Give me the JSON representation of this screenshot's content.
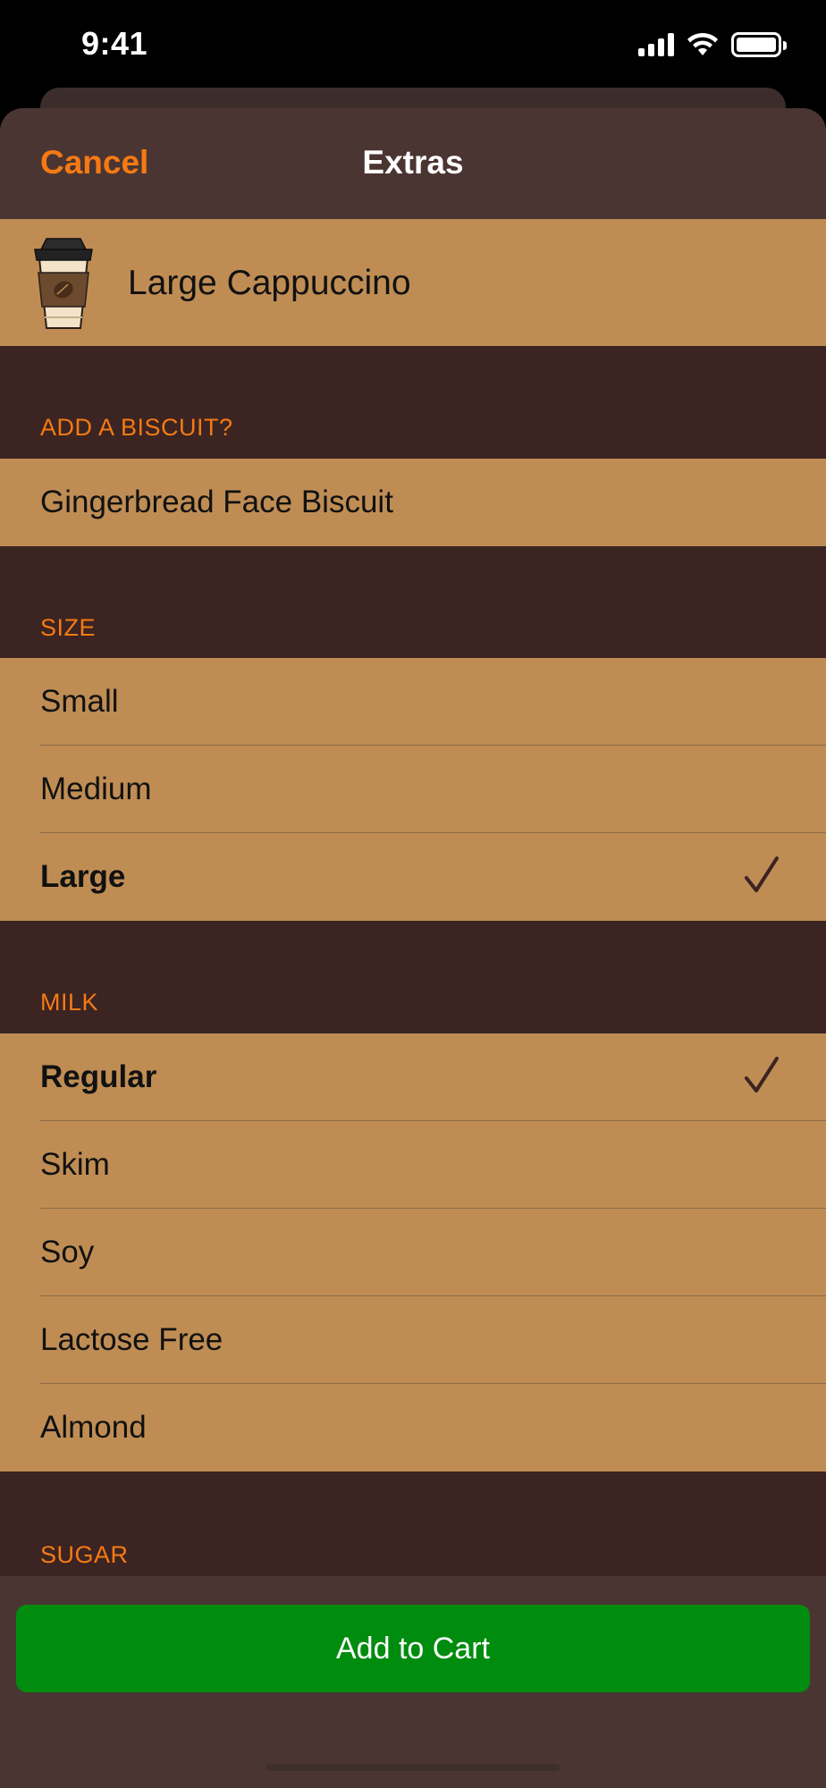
{
  "status_bar": {
    "time": "9:41"
  },
  "navbar": {
    "cancel_label": "Cancel",
    "title": "Extras"
  },
  "product": {
    "name": "Large Cappuccino",
    "icon": "coffee-cup-icon"
  },
  "sections": {
    "biscuit": {
      "header": "ADD A BISCUIT?",
      "items": [
        {
          "label": "Gingerbread Face Biscuit"
        }
      ]
    },
    "size": {
      "header": "SIZE",
      "items": [
        {
          "label": "Small"
        },
        {
          "label": "Medium"
        },
        {
          "label": "Large"
        }
      ],
      "selected": "Large"
    },
    "milk": {
      "header": "MILK",
      "items": [
        {
          "label": "Regular"
        },
        {
          "label": "Skim"
        },
        {
          "label": "Soy"
        },
        {
          "label": "Lactose Free"
        },
        {
          "label": "Almond"
        }
      ],
      "selected": "Regular"
    },
    "sugar": {
      "header": "SUGAR"
    }
  },
  "cta": {
    "label": "Add to Cart"
  },
  "colors": {
    "accent": "#f57a13",
    "row_bg": "#bf8d54",
    "sheet_bg": "#3b2422",
    "cta_bg": "#008c0e"
  }
}
